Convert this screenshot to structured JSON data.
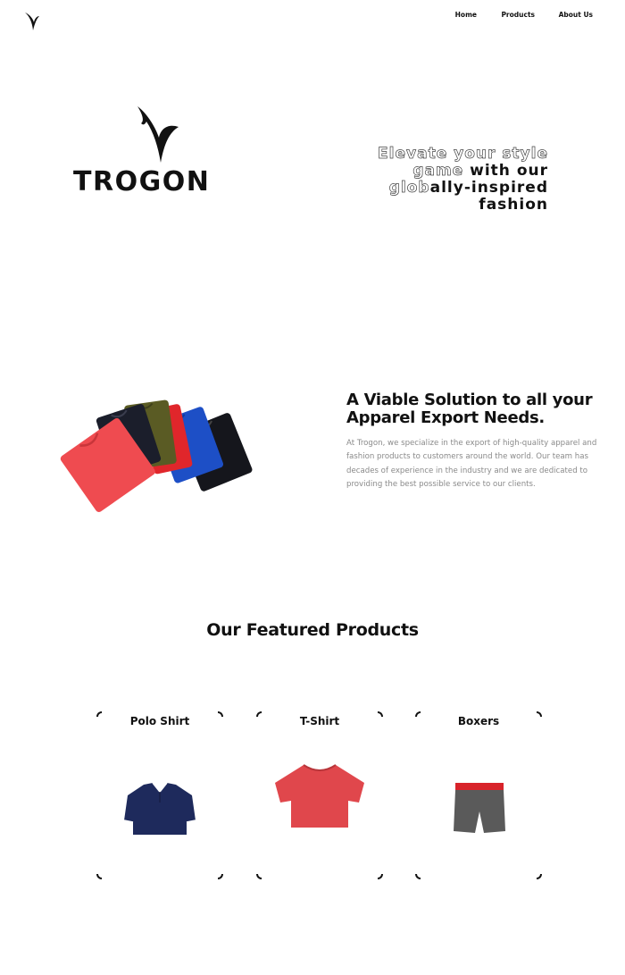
{
  "nav": {
    "items": [
      "Home",
      "Products",
      "About Us"
    ]
  },
  "hero": {
    "brand": "TROGON",
    "tagline": {
      "line1": "Elevate your style",
      "line2_outline": "game ",
      "line2_solid": "with our",
      "line3_outline": "glob",
      "line3_solid": "ally-inspired",
      "line4": "fashion"
    }
  },
  "about": {
    "heading": "A Viable Solution to all your Apparel Export Needs.",
    "body": "At Trogon, we specialize in the export of high-quality apparel and fashion products to customers around the world. Our team has decades of experience in the industry and we are dedicated to providing the best possible service to our clients."
  },
  "featured": {
    "title": "Our Featured Products",
    "products": [
      {
        "name": "Polo Shirt",
        "icon": "polo-shirt-image",
        "color": "#1e2a5c"
      },
      {
        "name": "T-Shirt",
        "icon": "tshirt-image",
        "color": "#e0474c"
      },
      {
        "name": "Boxers",
        "icon": "boxers-image",
        "color": "#5a5a5a"
      }
    ]
  },
  "colors": {
    "text": "#111111",
    "muted": "#8a8a8a",
    "background": "#ffffff"
  }
}
